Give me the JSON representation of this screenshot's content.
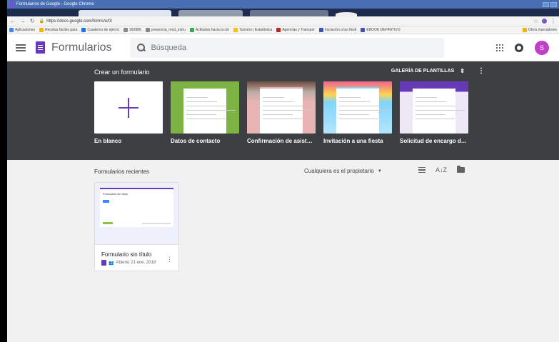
{
  "browser": {
    "window_title": "Formularios de Google - Google Chrome",
    "url": "https://docs.google.com/forms/u/0/",
    "bookmarks": [
      {
        "label": "Aplicaciones",
        "color": "#4285f4"
      },
      {
        "label": "Recetas fáciles para",
        "color": "#f4b400"
      },
      {
        "label": "Cuaderno de ejercic",
        "color": "#1a73e8"
      },
      {
        "label": "182886",
        "color": "#888888"
      },
      {
        "label": "presencia_mod_estru",
        "color": "#888888"
      },
      {
        "label": "Actitudes hacia la cie",
        "color": "#34a853"
      },
      {
        "label": "Turismo | Estadística",
        "color": "#fbbc04"
      },
      {
        "label": "Agencias y Transpor",
        "color": "#c5221f"
      },
      {
        "label": "Iniciación a las fiesti",
        "color": "#3f51b5"
      },
      {
        "label": "EBOOK DEFINITIVO",
        "color": "#3f51b5"
      }
    ],
    "other_bookmarks": "Otros marcadores"
  },
  "header": {
    "app_title": "Formularios",
    "search_placeholder": "Búsqueda",
    "avatar_letter": "S"
  },
  "gallery": {
    "title": "Crear un formulario",
    "gallery_label": "GALERÍA DE PLANTILLAS",
    "templates": [
      {
        "label": "En blanco",
        "kind": "blank"
      },
      {
        "label": "Datos de contacto",
        "kind": "contact",
        "color": "#7cb342"
      },
      {
        "label": "Confirmación de asisten...",
        "kind": "rsvp",
        "color": "#e0a8a8"
      },
      {
        "label": "Invitación a una fiesta",
        "kind": "party",
        "color": "#81d4fa"
      },
      {
        "label": "Solicitud de encargo de ...",
        "kind": "order",
        "color": "#673ab7"
      }
    ]
  },
  "recent": {
    "title": "Formularios recientes",
    "owner_filter": "Cualquiera es el propietario",
    "forms": [
      {
        "name": "Formulario sin título",
        "opened": "Abierto 21 ene. 2018",
        "thumb_title": "Formulario sin título"
      }
    ]
  }
}
